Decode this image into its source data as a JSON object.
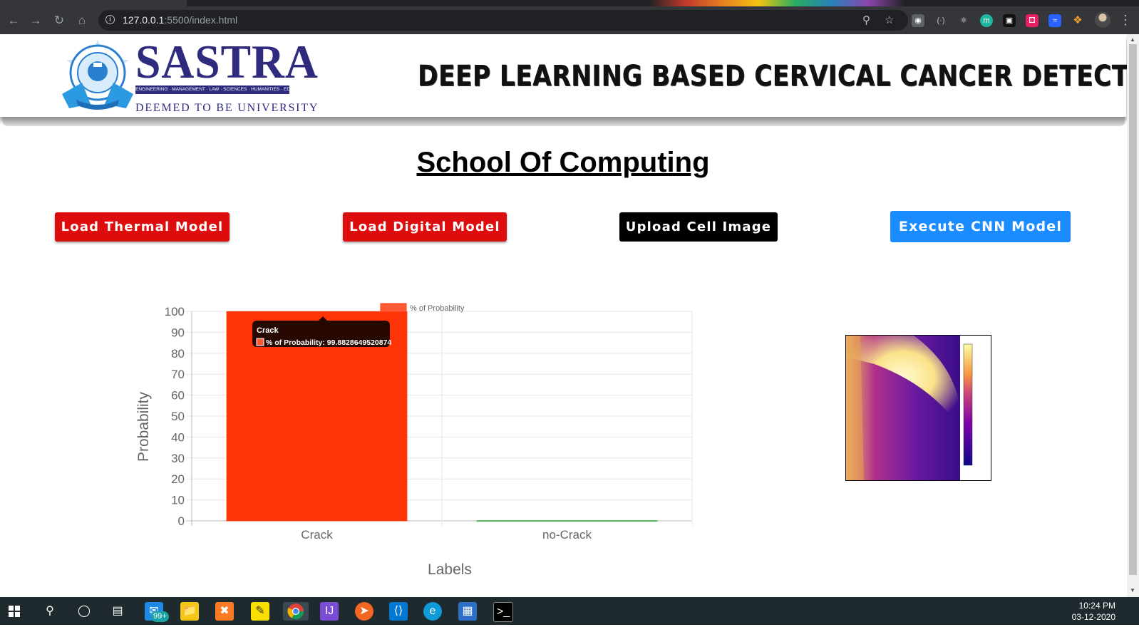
{
  "browser": {
    "url_host": "127.0.0.1",
    "url_path": ":5500/index.html"
  },
  "header": {
    "brand": "SASTRA",
    "brand_strip": "ENGINEERING · MANAGEMENT · LAW · SCIENCES · HUMANITIES · EDUCATION",
    "brand_sub": "DEEMED TO BE UNIVERSITY",
    "title": "DEEP LEARNING BASED CERVICAL CANCER DETECTION"
  },
  "main": {
    "school": "School Of Computing",
    "buttons": {
      "thermal": "Load Thermal Model",
      "digital": "Load Digital Model",
      "upload": "Upload Cell Image",
      "execute": "Execute CNN Model"
    }
  },
  "chart_data": {
    "type": "bar",
    "categories": [
      "Crack",
      "no-Crack"
    ],
    "series": [
      {
        "name": "% of Probability",
        "values": [
          99.8828649520874,
          0.1171350479126
        ]
      }
    ],
    "xlabel": "Labels",
    "ylabel": "Probability",
    "ylim": [
      0,
      100
    ],
    "yticks": [
      0,
      10,
      20,
      30,
      40,
      50,
      60,
      70,
      80,
      90,
      100
    ],
    "legend": "top",
    "grid": true,
    "colors": {
      "Crack": "#ff3508",
      "no-Crack": "#4caf50"
    },
    "tooltip": {
      "title": "Crack",
      "text": "% of Probability: 99.8828649520874"
    }
  },
  "taskbar": {
    "badge": "99+",
    "time": "10:24 PM",
    "date": "03-12-2020"
  }
}
